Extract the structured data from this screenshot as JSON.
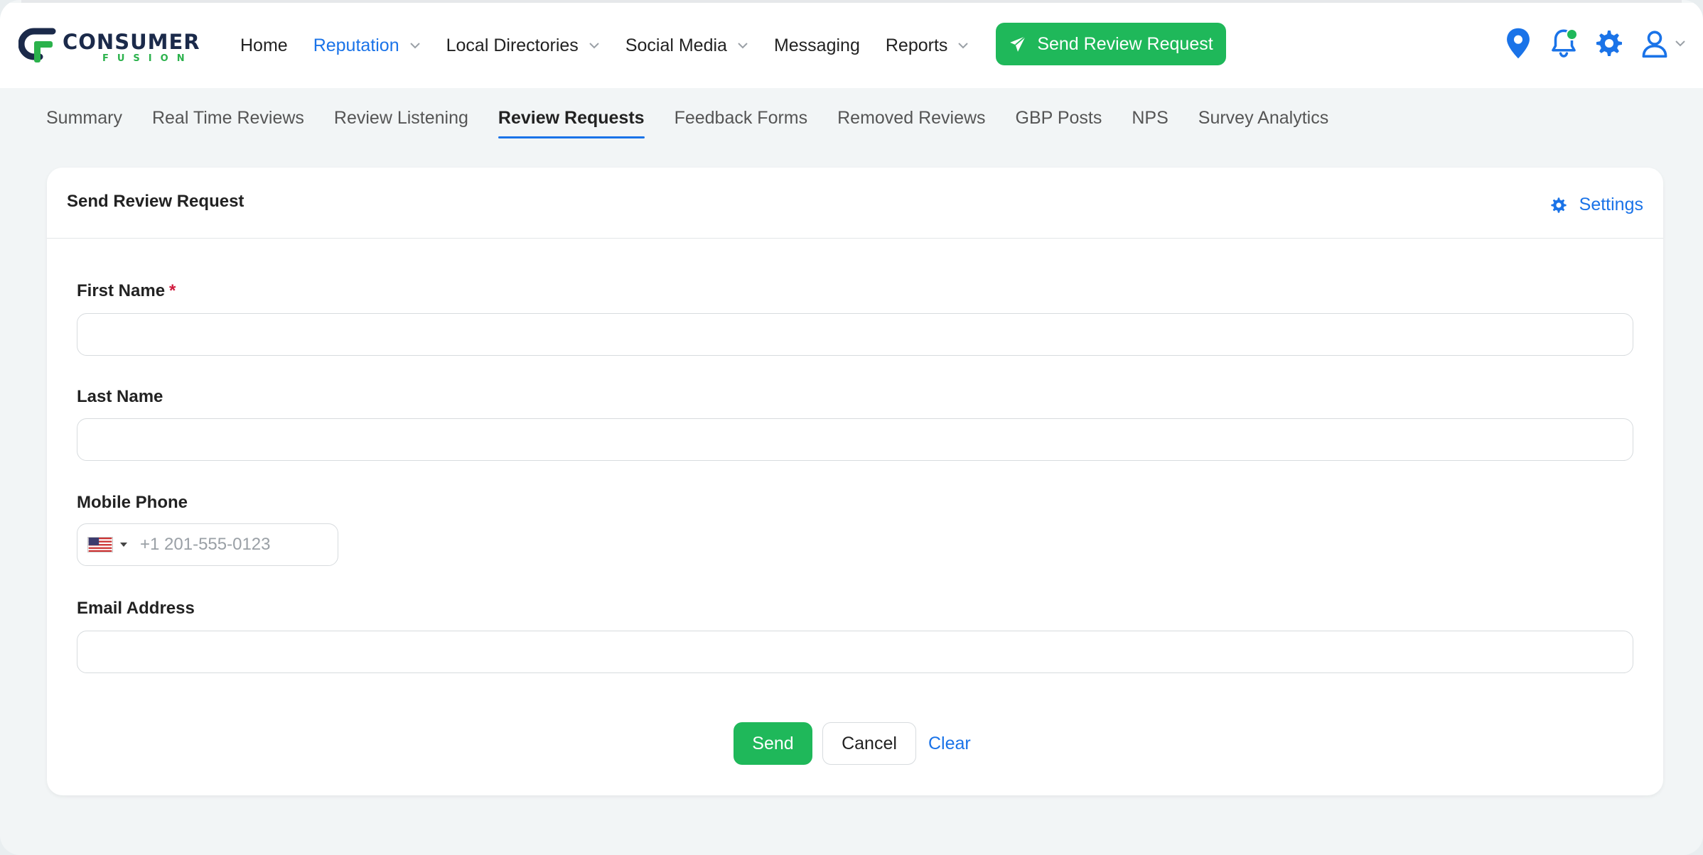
{
  "brand": {
    "name": "CONSUMER",
    "tagline": "FUSION"
  },
  "nav": {
    "items": [
      {
        "label": "Home",
        "active": false,
        "dropdown": false
      },
      {
        "label": "Reputation",
        "active": true,
        "dropdown": true
      },
      {
        "label": "Local Directories",
        "active": false,
        "dropdown": true
      },
      {
        "label": "Social Media",
        "active": false,
        "dropdown": true
      },
      {
        "label": "Messaging",
        "active": false,
        "dropdown": false
      },
      {
        "label": "Reports",
        "active": false,
        "dropdown": true
      }
    ],
    "cta_label": "Send Review Request"
  },
  "header_icons": [
    "location-pin-icon",
    "bell-icon",
    "gear-icon",
    "user-icon"
  ],
  "tabs": [
    {
      "label": "Summary",
      "active": false
    },
    {
      "label": "Real Time Reviews",
      "active": false
    },
    {
      "label": "Review Listening",
      "active": false
    },
    {
      "label": "Review Requests",
      "active": true
    },
    {
      "label": "Feedback Forms",
      "active": false
    },
    {
      "label": "Removed Reviews",
      "active": false
    },
    {
      "label": "GBP Posts",
      "active": false
    },
    {
      "label": "NPS",
      "active": false
    },
    {
      "label": "Survey Analytics",
      "active": false
    }
  ],
  "card": {
    "title": "Send Review Request",
    "settings_label": "Settings"
  },
  "form": {
    "first_name": {
      "label": "First Name",
      "required_mark": "*",
      "value": ""
    },
    "last_name": {
      "label": "Last Name",
      "value": ""
    },
    "mobile_phone": {
      "label": "Mobile Phone",
      "country": "US",
      "placeholder": "+1 201-555-0123",
      "value": ""
    },
    "email": {
      "label": "Email Address",
      "value": ""
    }
  },
  "actions": {
    "send_label": "Send",
    "cancel_label": "Cancel",
    "clear_label": "Clear"
  },
  "colors": {
    "accent_blue": "#1a73e8",
    "brand_green": "#1fb85a",
    "required_red": "#d0193c",
    "logo_navy": "#1b2a4a"
  }
}
